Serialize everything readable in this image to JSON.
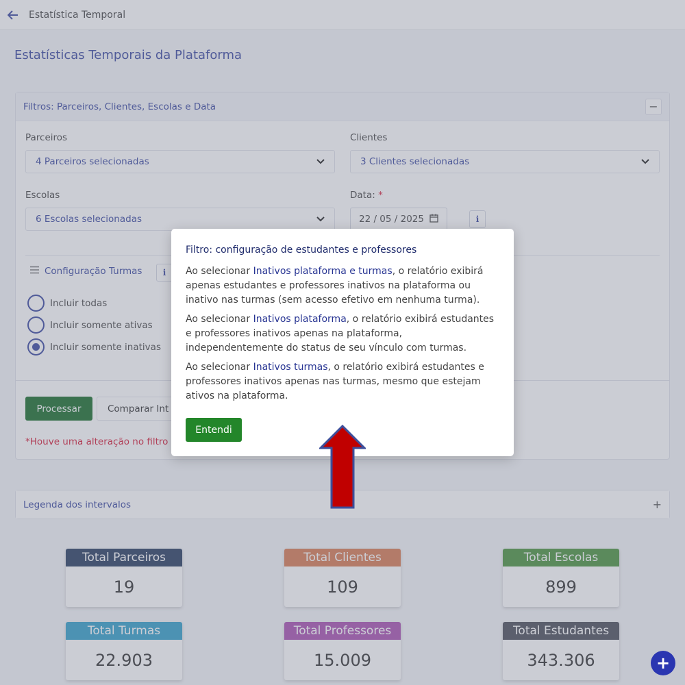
{
  "header": {
    "title": "Estatística Temporal"
  },
  "page_title": "Estatísticas Temporais da Plataforma",
  "filters": {
    "title": "Filtros: Parceiros, Clientes, Escolas e Data",
    "collapse_symbol": "−",
    "parceiros": {
      "label": "Parceiros",
      "value": "4 Parceiros selecionadas"
    },
    "clientes": {
      "label": "Clientes",
      "value": "3 Clientes selecionadas"
    },
    "escolas": {
      "label": "Escolas",
      "value": "6 Escolas selecionadas"
    },
    "data": {
      "label": "Data:",
      "required_mark": "*",
      "value": "22 / 05 / 2025"
    },
    "info_symbol": "i",
    "turmas": {
      "title": "Configuração Turmas",
      "options": [
        {
          "label": "Incluir todas",
          "checked": false
        },
        {
          "label": "Incluir somente ativas",
          "checked": false
        },
        {
          "label": "Incluir somente inativas",
          "checked": true
        }
      ]
    },
    "process_button": "Processar",
    "compare_button": "Comparar Int",
    "warning": "*Houve uma alteração no filtro"
  },
  "legend_panel": {
    "title": "Legenda dos intervalos",
    "expand_symbol": "+"
  },
  "stats": [
    {
      "label": "Total Parceiros",
      "value": "19",
      "color": "#3a4d6e"
    },
    {
      "label": "Total Clientes",
      "value": "109",
      "color": "#dc8762"
    },
    {
      "label": "Total Escolas",
      "value": "899",
      "color": "#5b9d4f"
    },
    {
      "label": "Total Turmas",
      "value": "22.903",
      "color": "#45a9cf"
    },
    {
      "label": "Total Professores",
      "value": "15.009",
      "color": "#b260b9"
    },
    {
      "label": "Total Estudantes",
      "value": "343.306",
      "color": "#5a5e68"
    }
  ],
  "fab_symbol": "+",
  "modal": {
    "title": "Filtro: configuração de estudantes e professores",
    "p1_pre": "Ao selecionar ",
    "p1_hl": "Inativos plataforma e turmas",
    "p1_post": ", o relatório exibirá apenas estudantes e professores inativos na plataforma ou inativo nas turmas (sem acesso efetivo em nenhuma turma).",
    "p2_pre": "Ao selecionar ",
    "p2_hl": "Inativos plataforma",
    "p2_post": ", o relatório exibirá estudantes e professores inativos apenas na plataforma, independentemente do status de seu vínculo com turmas.",
    "p3_pre": "Ao selecionar ",
    "p3_hl": "Inativos turmas",
    "p3_post": ", o relatório exibirá estudantes e professores inativos apenas nas turmas, mesmo que estejam ativos na plataforma.",
    "ok_button": "Entendi"
  },
  "colors": {
    "accent": "#4a57a8",
    "modal_button": "#23862a",
    "arrow_fill": "#c00000",
    "arrow_border": "#3d4f9b"
  }
}
